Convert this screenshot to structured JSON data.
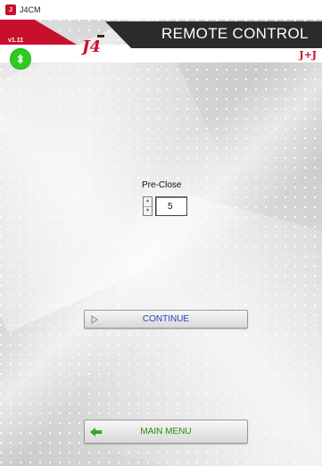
{
  "window": {
    "title": "J4CM"
  },
  "header": {
    "version": "v1.11",
    "title": "REMOTE CONTROL",
    "logo_text": "J4",
    "brand": "J+J"
  },
  "icons": {
    "bluetooth": "bluetooth-icon",
    "continue": "play-outline-icon",
    "main_menu": "arrow-left-icon"
  },
  "preclose": {
    "label": "Pre-Close",
    "value": "5"
  },
  "buttons": {
    "continue": "CONTINUE",
    "main_menu": "MAIN MENU"
  },
  "colors": {
    "brand_red": "#c8102e",
    "header_dark": "#2b2b2b",
    "bluetooth_green": "#2ecc1f",
    "continue_text": "#2a3fbf",
    "main_menu_text": "#2b8a14"
  }
}
